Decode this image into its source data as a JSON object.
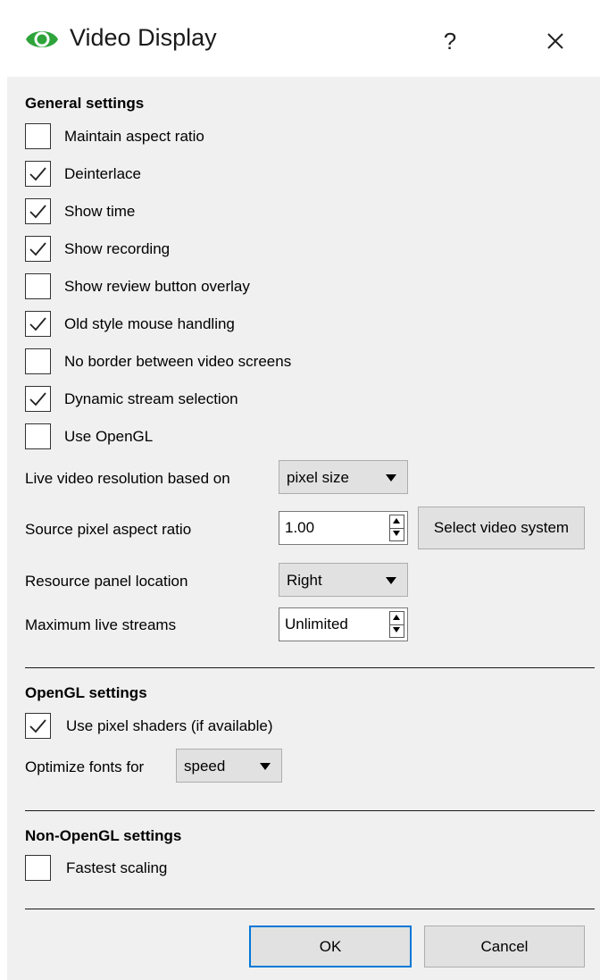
{
  "window": {
    "title": "Video Display",
    "help_label": "?",
    "icon": "eye-icon",
    "accent": "#2ea43a"
  },
  "general": {
    "title": "General settings",
    "checkboxes": [
      {
        "label": "Maintain aspect ratio",
        "checked": false
      },
      {
        "label": "Deinterlace",
        "checked": true
      },
      {
        "label": "Show time",
        "checked": true
      },
      {
        "label": "Show recording",
        "checked": true
      },
      {
        "label": "Show review button overlay",
        "checked": false
      },
      {
        "label": "Old style mouse handling",
        "checked": true
      },
      {
        "label": "No border between video screens",
        "checked": false
      },
      {
        "label": "Dynamic stream selection",
        "checked": true
      },
      {
        "label": "Use OpenGL",
        "checked": false
      }
    ],
    "live_resolution": {
      "label": "Live video resolution based on",
      "value": "pixel size"
    },
    "aspect": {
      "label": "Source pixel aspect ratio",
      "value": "1.00",
      "button": "Select video system"
    },
    "panel_location": {
      "label": "Resource panel location",
      "value": "Right"
    },
    "max_streams": {
      "label": "Maximum live streams",
      "value": "Unlimited"
    }
  },
  "opengl": {
    "title": "OpenGL settings",
    "shaders": {
      "label": "Use pixel shaders (if available)",
      "checked": true
    },
    "fonts": {
      "label": "Optimize fonts for",
      "value": "speed"
    }
  },
  "non_opengl": {
    "title": "Non-OpenGL settings",
    "fastest": {
      "label": "Fastest scaling",
      "checked": false
    }
  },
  "buttons": {
    "ok": "OK",
    "cancel": "Cancel"
  }
}
